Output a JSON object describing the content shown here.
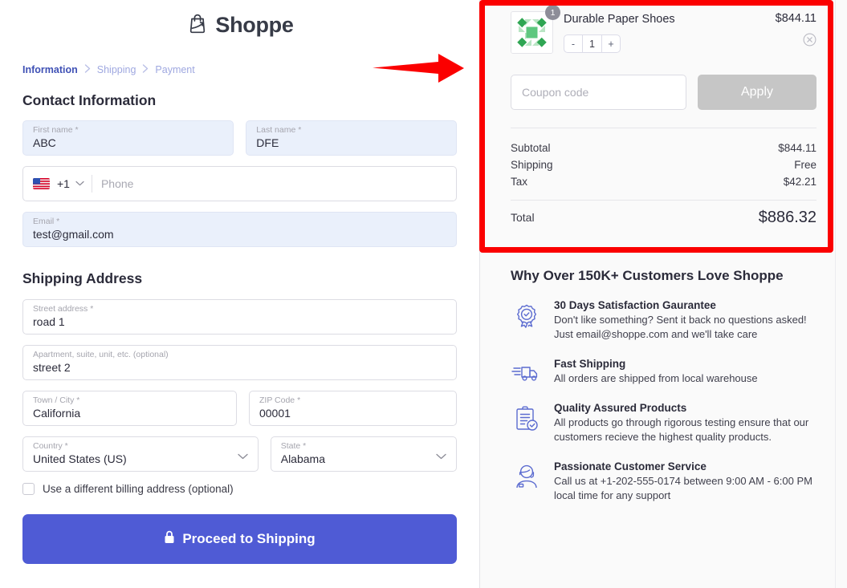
{
  "brand": {
    "name": "Shoppe",
    "logo_icon": "shopping-bag-icon"
  },
  "breadcrumb": {
    "steps": [
      {
        "label": "Information",
        "state": "active"
      },
      {
        "label": "Shipping",
        "state": "inactive"
      },
      {
        "label": "Payment",
        "state": "inactive"
      }
    ],
    "separator": "›"
  },
  "contact": {
    "heading": "Contact Information",
    "first_name": {
      "label": "First name *",
      "value": "ABC"
    },
    "last_name": {
      "label": "Last name *",
      "value": "DFE"
    },
    "phone": {
      "country_code": "+1",
      "flag": "us-flag-icon",
      "placeholder": "Phone",
      "value": ""
    },
    "email": {
      "label": "Email *",
      "value": "test@gmail.com"
    }
  },
  "shipping": {
    "heading": "Shipping Address",
    "street": {
      "label": "Street address *",
      "value": "road 1"
    },
    "apartment": {
      "label": "Apartment, suite, unit, etc. (optional)",
      "value": "street 2"
    },
    "city": {
      "label": "Town / City *",
      "value": "California"
    },
    "zip": {
      "label": "ZIP Code *",
      "value": "00001"
    },
    "country": {
      "label": "Country *",
      "value": "United States (US)"
    },
    "state": {
      "label": "State *",
      "value": "Alabama"
    },
    "billing_checkbox": {
      "label": "Use a different billing address (optional)",
      "checked": false
    }
  },
  "cta": {
    "label": "Proceed to Shipping",
    "icon": "lock-icon",
    "color": "#4f5bd5"
  },
  "order": {
    "item": {
      "name": "Durable Paper Shoes",
      "price": "$844.11",
      "badge_qty": "1",
      "qty": "1",
      "minus": "-",
      "plus": "+",
      "remove_icon": "remove-circle-icon",
      "thumb_icon": "product-thumbnail"
    },
    "coupon": {
      "placeholder": "Coupon code",
      "value": "",
      "apply_label": "Apply"
    },
    "totals": [
      {
        "label": "Subtotal",
        "value": "$844.11"
      },
      {
        "label": "Shipping",
        "value": "Free"
      },
      {
        "label": "Tax",
        "value": "$42.21"
      }
    ],
    "total": {
      "label": "Total",
      "value": "$886.32"
    }
  },
  "benefits": {
    "title": "Why Over 150K+ Customers Love Shoppe",
    "items": [
      {
        "icon": "badge-check-icon",
        "title": "30 Days Satisfaction Gaurantee",
        "desc": "Don't like something? Sent it back no questions asked! Just email@shoppe.com and we'll take care"
      },
      {
        "icon": "delivery-truck-icon",
        "title": "Fast Shipping",
        "desc": "All orders are shipped from local warehouse"
      },
      {
        "icon": "clipboard-check-icon",
        "title": "Quality Assured Products",
        "desc": "All products go through rigorous testing ensure that our customers recieve the highest quality products."
      },
      {
        "icon": "headset-agent-icon",
        "title": "Passionate Customer Service",
        "desc": "Call us at +1-202-555-0174 between 9:00 AM - 6:00 PM local time for any support"
      }
    ]
  },
  "annotations": {
    "highlight_color": "#fb0000",
    "arrow_icon": "right-arrow-annotation",
    "box_icon": "highlight-box-annotation"
  }
}
